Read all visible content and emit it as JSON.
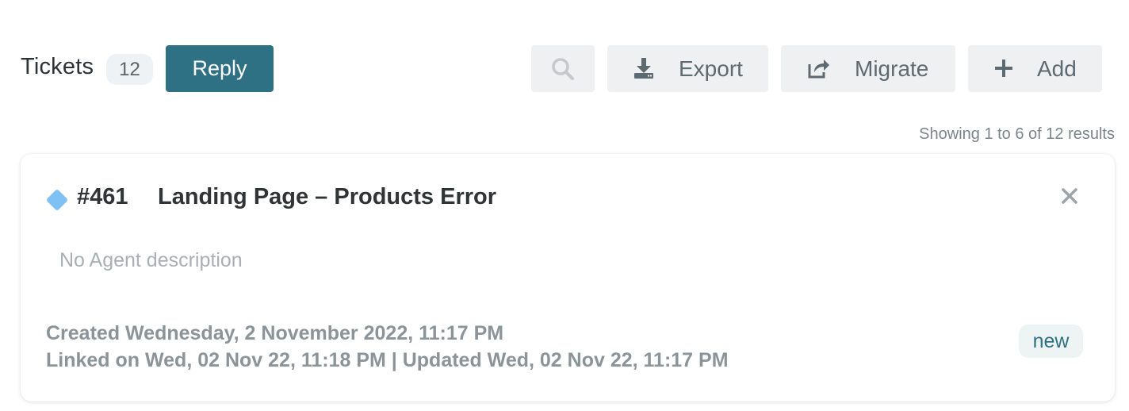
{
  "header": {
    "title": "Tickets",
    "count": "12",
    "reply_label": "Reply"
  },
  "toolbar": {
    "search_icon": "search-icon",
    "export_label": "Export",
    "export_icon": "download-icon",
    "migrate_label": "Migrate",
    "migrate_icon": "share-icon",
    "add_label": "Add",
    "add_icon": "plus-icon"
  },
  "results_text": "Showing 1 to 6 of 12 results",
  "ticket": {
    "id": "#461",
    "title": "Landing Page – Products Error",
    "priority_icon": "diamond-icon",
    "description": "No Agent description",
    "created": "Created Wednesday, 2 November 2022, 11:17 PM",
    "linked_updated": "Linked on Wed, 02 Nov 22, 11:18 PM | Updated Wed, 02 Nov 22, 11:17 PM",
    "status": "new"
  },
  "colors": {
    "primary": "#2f7184",
    "priority_diamond": "#7fc0f5",
    "button_bg": "#eef0f1"
  }
}
